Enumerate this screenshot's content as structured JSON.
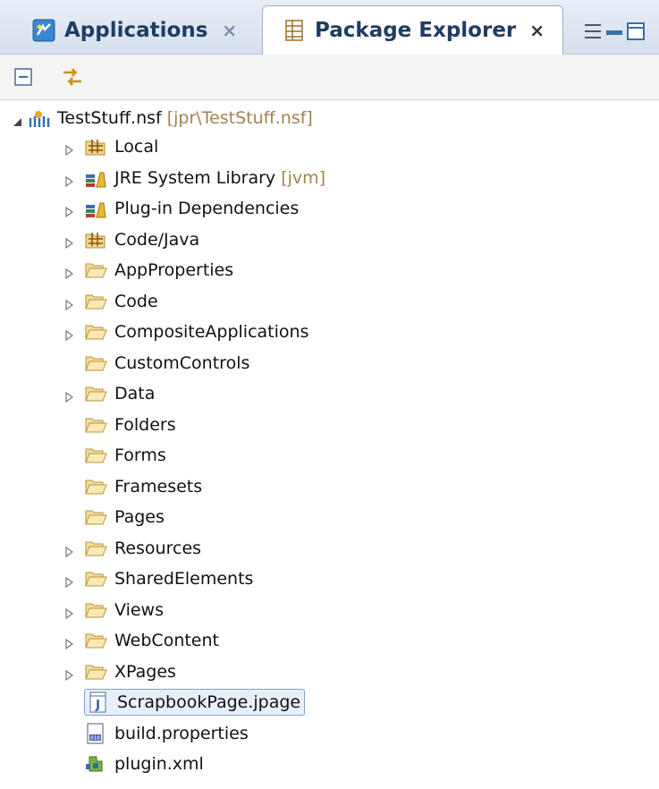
{
  "tabs": [
    {
      "label": "Applications",
      "icon": "applications-icon",
      "close": "×"
    },
    {
      "label": "Package Explorer",
      "icon": "package-explorer-icon",
      "close": "×"
    }
  ],
  "view_menu_icon": "view-menu-icon",
  "toolbar": {
    "collapse_all_icon": "collapse-all-icon",
    "link_with_editor_icon": "link-with-editor-icon"
  },
  "tree": {
    "root": {
      "label": "TestStuff.nsf",
      "decoration": "[jpr\\TestStuff.nsf]",
      "icon": "nsf-project-icon"
    },
    "items": [
      {
        "label": "Local",
        "decoration": "",
        "icon": "source-folder-icon",
        "expandable": true
      },
      {
        "label": "JRE System Library",
        "decoration": "[jvm]",
        "icon": "library-icon",
        "expandable": true
      },
      {
        "label": "Plug-in Dependencies",
        "decoration": "",
        "icon": "library-icon",
        "expandable": true
      },
      {
        "label": "Code/Java",
        "decoration": "",
        "icon": "source-folder-icon",
        "expandable": true
      },
      {
        "label": "AppProperties",
        "decoration": "",
        "icon": "folder-icon",
        "expandable": true
      },
      {
        "label": "Code",
        "decoration": "",
        "icon": "folder-icon",
        "expandable": true
      },
      {
        "label": "CompositeApplications",
        "decoration": "",
        "icon": "folder-icon",
        "expandable": true
      },
      {
        "label": "CustomControls",
        "decoration": "",
        "icon": "folder-icon",
        "expandable": false
      },
      {
        "label": "Data",
        "decoration": "",
        "icon": "folder-icon",
        "expandable": true
      },
      {
        "label": "Folders",
        "decoration": "",
        "icon": "folder-icon",
        "expandable": false
      },
      {
        "label": "Forms",
        "decoration": "",
        "icon": "folder-icon",
        "expandable": false
      },
      {
        "label": "Framesets",
        "decoration": "",
        "icon": "folder-icon",
        "expandable": false
      },
      {
        "label": "Pages",
        "decoration": "",
        "icon": "folder-icon",
        "expandable": false
      },
      {
        "label": "Resources",
        "decoration": "",
        "icon": "folder-icon",
        "expandable": true
      },
      {
        "label": "SharedElements",
        "decoration": "",
        "icon": "folder-icon",
        "expandable": true
      },
      {
        "label": "Views",
        "decoration": "",
        "icon": "folder-icon",
        "expandable": true
      },
      {
        "label": "WebContent",
        "decoration": "",
        "icon": "folder-icon",
        "expandable": true
      },
      {
        "label": "XPages",
        "decoration": "",
        "icon": "folder-icon",
        "expandable": true
      },
      {
        "label": "ScrapbookPage.jpage",
        "decoration": "",
        "icon": "java-scrapbook-icon",
        "expandable": false,
        "selected": true
      },
      {
        "label": "build.properties",
        "decoration": "",
        "icon": "properties-file-icon",
        "expandable": false
      },
      {
        "label": "plugin.xml",
        "decoration": "",
        "icon": "plugin-xml-icon",
        "expandable": false
      }
    ]
  },
  "colors": {
    "decoration": "#a4824d",
    "selection_bg": "#e7effa",
    "selection_border": "#7ea1d3",
    "tab_text": "#1f3d63"
  }
}
